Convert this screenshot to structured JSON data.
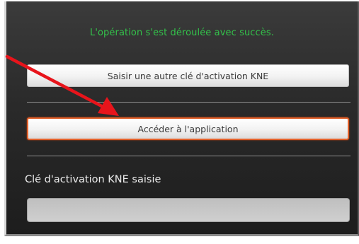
{
  "dialog": {
    "success_message": "L'opération s'est déroulée avec succès.",
    "other_key_button_label": "Saisir une autre clé d'activation KNE",
    "access_app_button_label": "Accéder à l'application",
    "entered_key_label": "Clé d'activation KNE saisie",
    "entered_key_value": ""
  },
  "annotation": {
    "arrow_color": "#e8141b",
    "arrow_icon": "annotation-arrow"
  },
  "colors": {
    "success_text": "#33c24a",
    "highlight_border": "#e0602a"
  }
}
